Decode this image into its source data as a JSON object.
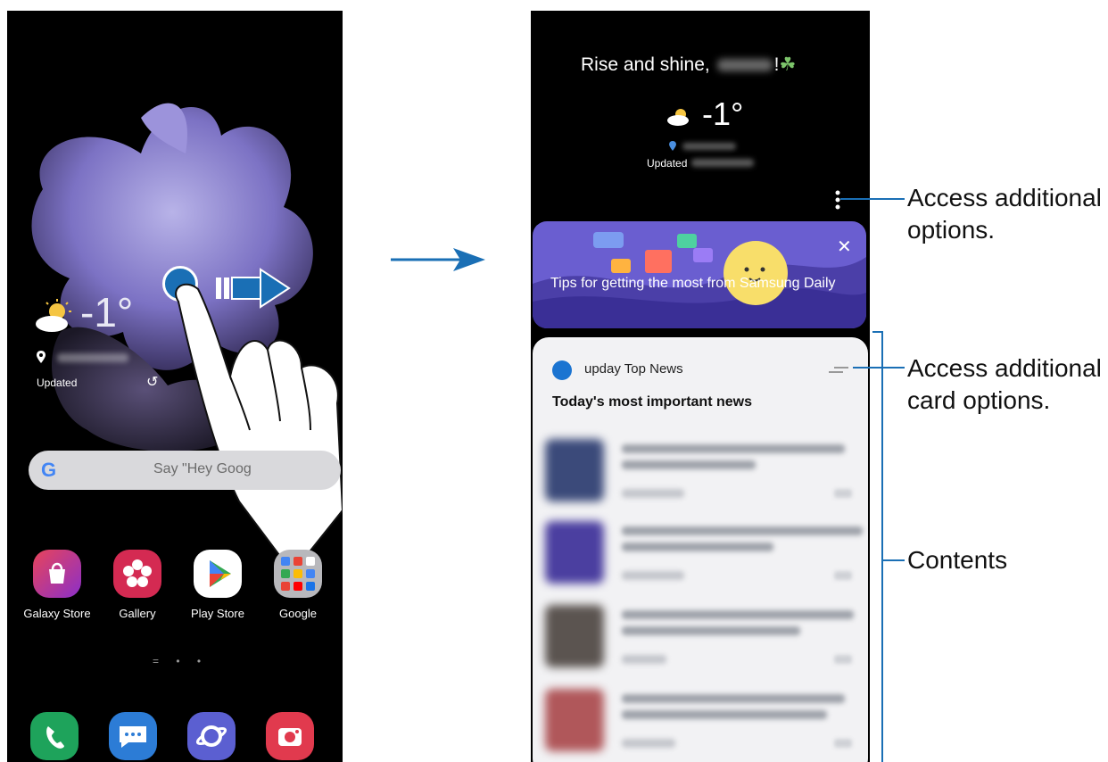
{
  "left_screen": {
    "weather": {
      "temperature": "-1°",
      "icon": "partly-cloudy-sun-icon"
    },
    "updated_label": "Updated",
    "search": {
      "placeholder": "Say \"Hey Goog"
    },
    "apps": [
      {
        "label": "Galaxy Store",
        "icon": "shopping-bag-icon",
        "color": "#c0338a"
      },
      {
        "label": "Gallery",
        "icon": "flower-icon",
        "color": "#d42a52"
      },
      {
        "label": "Play Store",
        "icon": "play-triangle-icon",
        "color": "#ffffff"
      },
      {
        "label": "Google",
        "icon": "google-apps-folder-icon",
        "color": "#b8b8bc"
      }
    ],
    "page_indicator": "= • •",
    "dock": [
      {
        "icon": "phone-icon",
        "color": "#1ea35b"
      },
      {
        "icon": "messages-icon",
        "color": "#2c7cd6"
      },
      {
        "icon": "internet-icon",
        "color": "#5b5fd1"
      },
      {
        "icon": "camera-icon",
        "color": "#e13a4e"
      }
    ]
  },
  "right_screen": {
    "greeting": {
      "prefix": "Rise and shine, ",
      "suffix": "!"
    },
    "weather": {
      "temperature": "-1°"
    },
    "updated_label": "Updated",
    "tips_card": {
      "text": "Tips for getting the most from Samsung Daily",
      "close_label": "✕"
    },
    "news_card": {
      "source": "upday Top News",
      "headline": "Today's most important news"
    }
  },
  "callouts": {
    "more_options": [
      "Access additional",
      "options."
    ],
    "card_options": [
      "Access additional",
      "card options."
    ],
    "contents": "Contents"
  },
  "colors": {
    "accent_blue": "#1a6fb5",
    "callout_line": "#1a6fb5"
  }
}
